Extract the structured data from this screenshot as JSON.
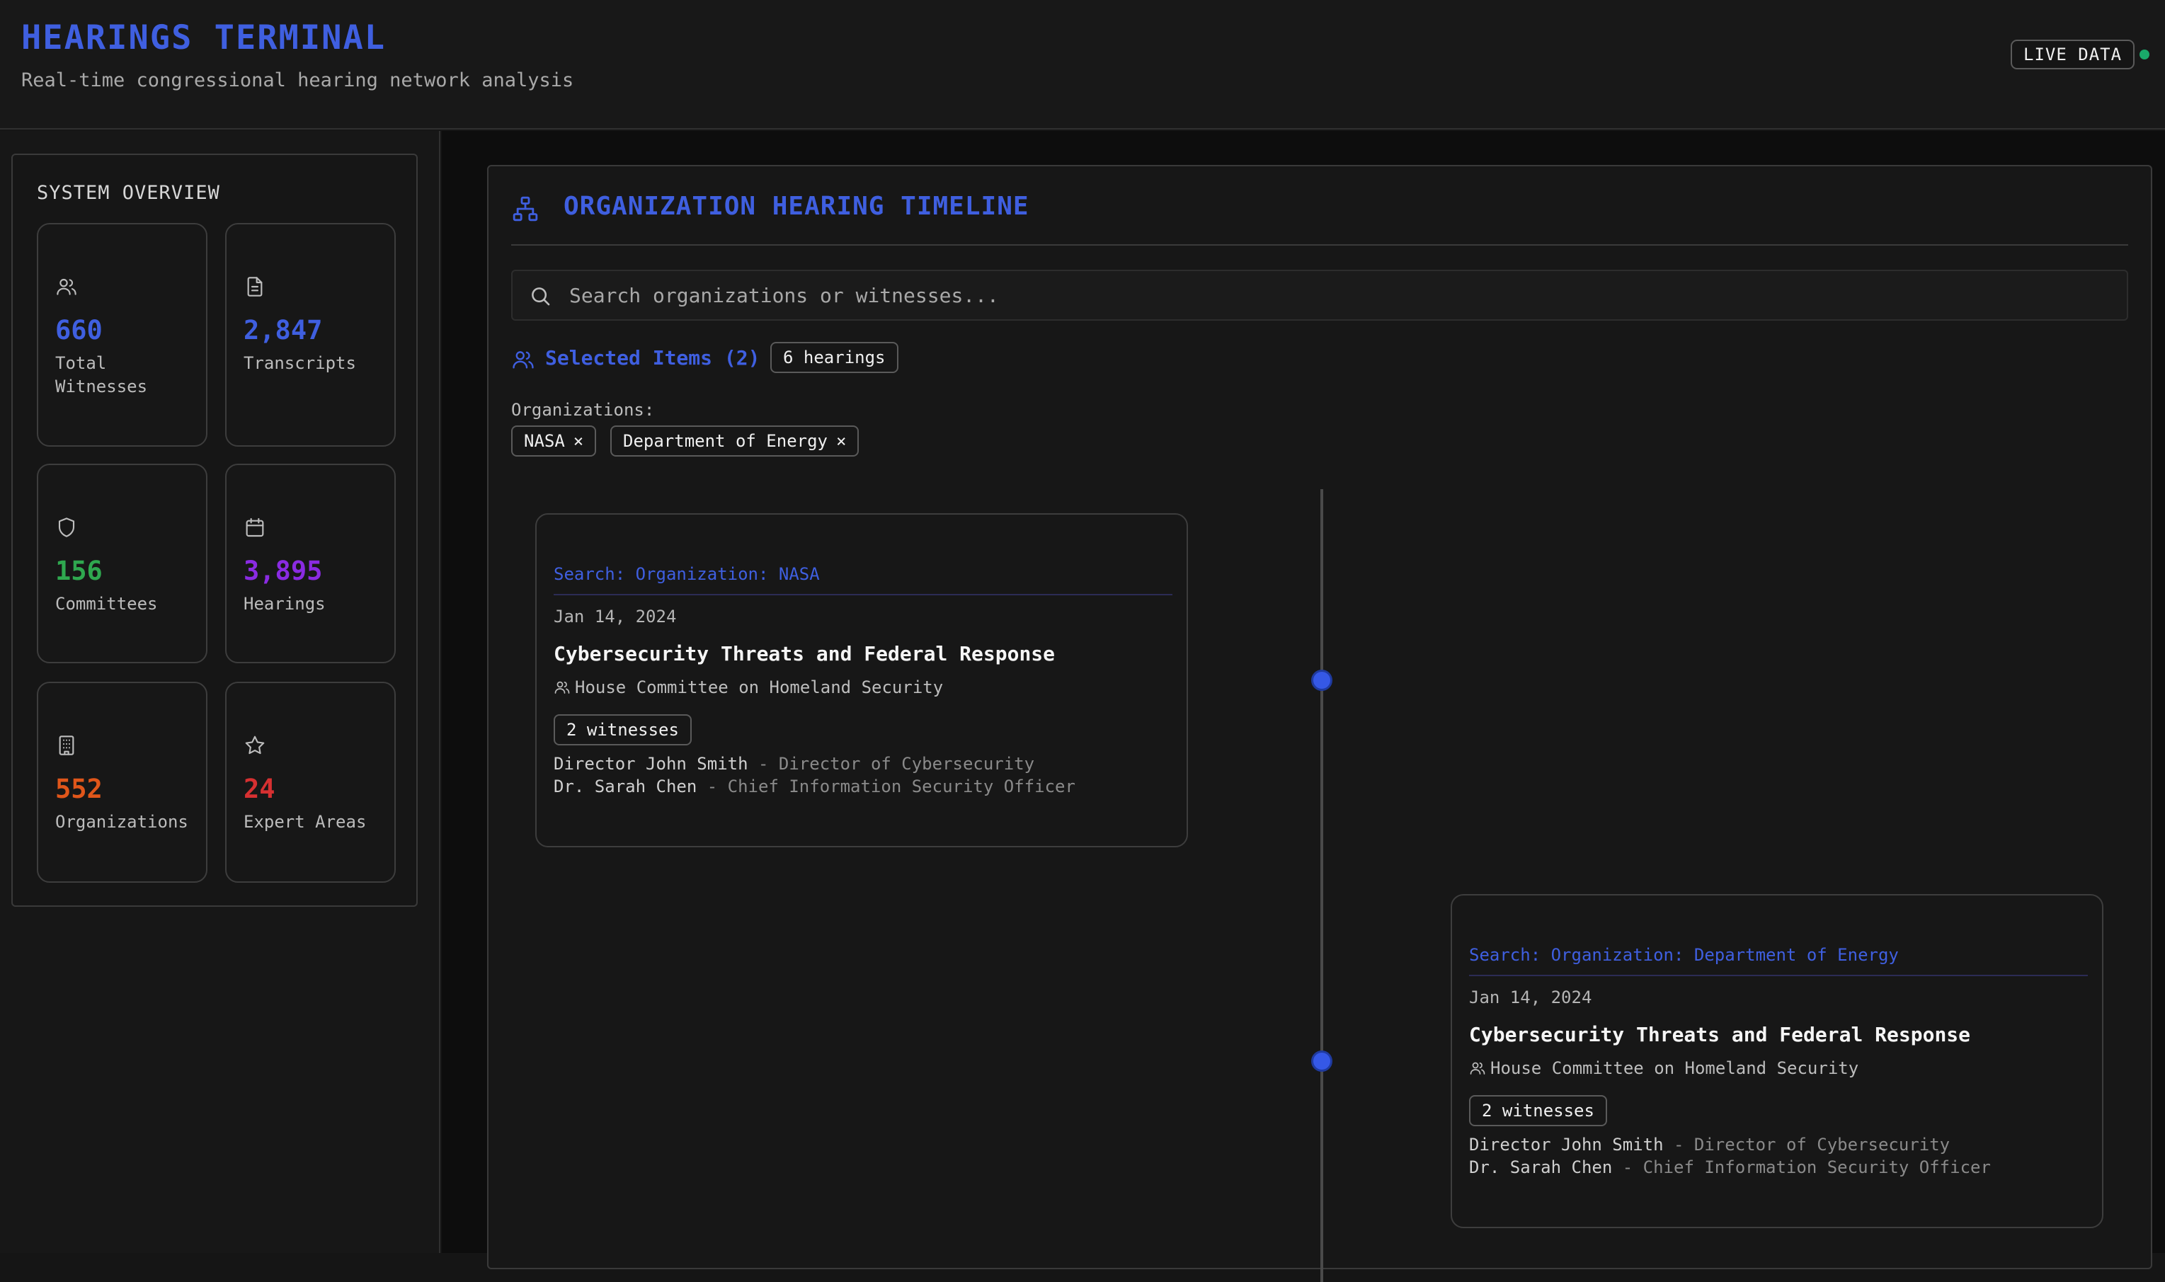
{
  "header": {
    "title": "HEARINGS TERMINAL",
    "subtitle": "Real-time congressional hearing network analysis",
    "live_badge": "LIVE DATA",
    "live_status_color": "#1aa96a"
  },
  "overview": {
    "title": "SYSTEM OVERVIEW",
    "stats": [
      {
        "icon": "users-icon",
        "value": "660",
        "label": "Total Witnesses",
        "color": "#3f5fe0"
      },
      {
        "icon": "document-icon",
        "value": "2,847",
        "label": "Transcripts",
        "color": "#3f5fe0"
      },
      {
        "icon": "shield-icon",
        "value": "156",
        "label": "Committees",
        "color": "#2fa84f"
      },
      {
        "icon": "calendar-icon",
        "value": "3,895",
        "label": "Hearings",
        "color": "#8a2be2"
      },
      {
        "icon": "building-icon",
        "value": "552",
        "label": "Organizations",
        "color": "#e0561a"
      },
      {
        "icon": "star-icon",
        "value": "24",
        "label": "Expert Areas",
        "color": "#d63031"
      }
    ]
  },
  "timeline": {
    "title": "ORGANIZATION HEARING TIMELINE",
    "search_placeholder": "Search organizations or witnesses...",
    "selected_label": "Selected Items (2)",
    "hearings_badge": "6 hearings",
    "organizations_label": "Organizations:",
    "organizations": [
      "NASA",
      "Department of Energy"
    ],
    "chip_close": "×",
    "cards": [
      {
        "search_tag": "Search: Organization: NASA",
        "date": "Jan 14, 2024",
        "title": "Cybersecurity Threats and Federal Response",
        "committee": "House Committee on Homeland Security",
        "witness_count": "2 witnesses",
        "witnesses": [
          {
            "name": "Director John Smith",
            "role": " - Director of Cybersecurity"
          },
          {
            "name": "Dr. Sarah Chen",
            "role": " - Chief Information Security Officer"
          }
        ]
      },
      {
        "search_tag": "Search: Organization: Department of Energy",
        "date": "Jan 14, 2024",
        "title": "Cybersecurity Threats and Federal Response",
        "committee": "House Committee on Homeland Security",
        "witness_count": "2 witnesses",
        "witnesses": [
          {
            "name": "Director John Smith",
            "role": " - Director of Cybersecurity"
          },
          {
            "name": "Dr. Sarah Chen",
            "role": " - Chief Information Security Officer"
          }
        ]
      }
    ]
  }
}
